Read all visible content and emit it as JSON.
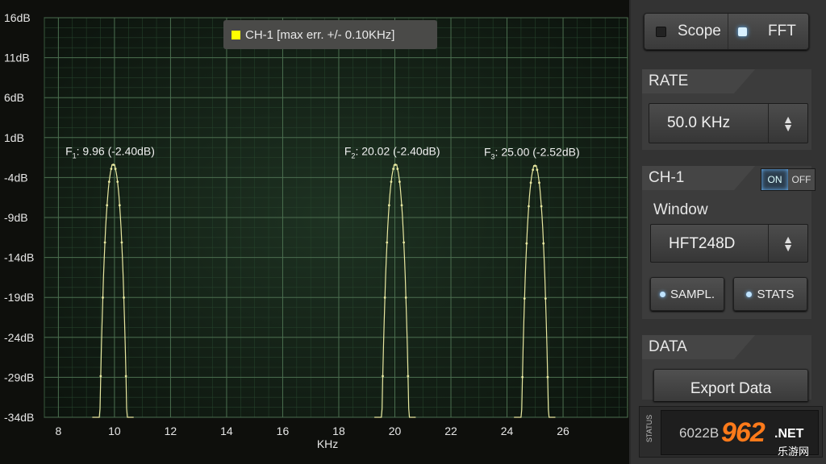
{
  "legend": {
    "label": "CH-1 [max err. +/- 0.10KHz]",
    "color": "#ffff00"
  },
  "chart_data": {
    "type": "line",
    "xlabel": "KHz",
    "ylabel": "",
    "xlim": [
      7.5,
      28.3
    ],
    "ylim": [
      -34,
      16
    ],
    "xticks": [
      8,
      10,
      12,
      14,
      16,
      18,
      20,
      22,
      24,
      26
    ],
    "yticks": [
      16,
      11,
      6,
      1,
      -4,
      -9,
      -14,
      -19,
      -24,
      -29,
      -34
    ],
    "ytick_labels": [
      "16dB",
      "11dB",
      "6dB",
      "1dB",
      "-4dB",
      "-9dB",
      "-14dB",
      "-19dB",
      "-24dB",
      "-29dB",
      "-34dB"
    ],
    "grid": true,
    "line_color": "#e8e8a0",
    "peaks": [
      {
        "label": "F",
        "sub": "1",
        "text": ": 9.96 (-2.40dB)",
        "x": 9.96,
        "y": -2.4
      },
      {
        "label": "F",
        "sub": "2",
        "text": ": 20.02 (-2.40dB)",
        "x": 20.02,
        "y": -2.4
      },
      {
        "label": "F",
        "sub": "3",
        "text": ": 25.00 (-2.52dB)",
        "x": 25.0,
        "y": -2.52
      }
    ]
  },
  "mode": {
    "scope": "Scope",
    "fft": "FFT"
  },
  "rate": {
    "title": "RATE",
    "value": "50.0 KHz"
  },
  "channel": {
    "title": "CH-1",
    "on": "ON",
    "off": "OFF",
    "window_label": "Window",
    "window_value": "HFT248D",
    "sampl": "SAMPL.",
    "stats": "STATS"
  },
  "data_section": {
    "title": "DATA",
    "export": "Export Data",
    "status_label": "STATUS",
    "status_value": "6022B"
  },
  "watermark": {
    "text": "962",
    "sub": ".NET",
    "cn": "乐游网"
  }
}
